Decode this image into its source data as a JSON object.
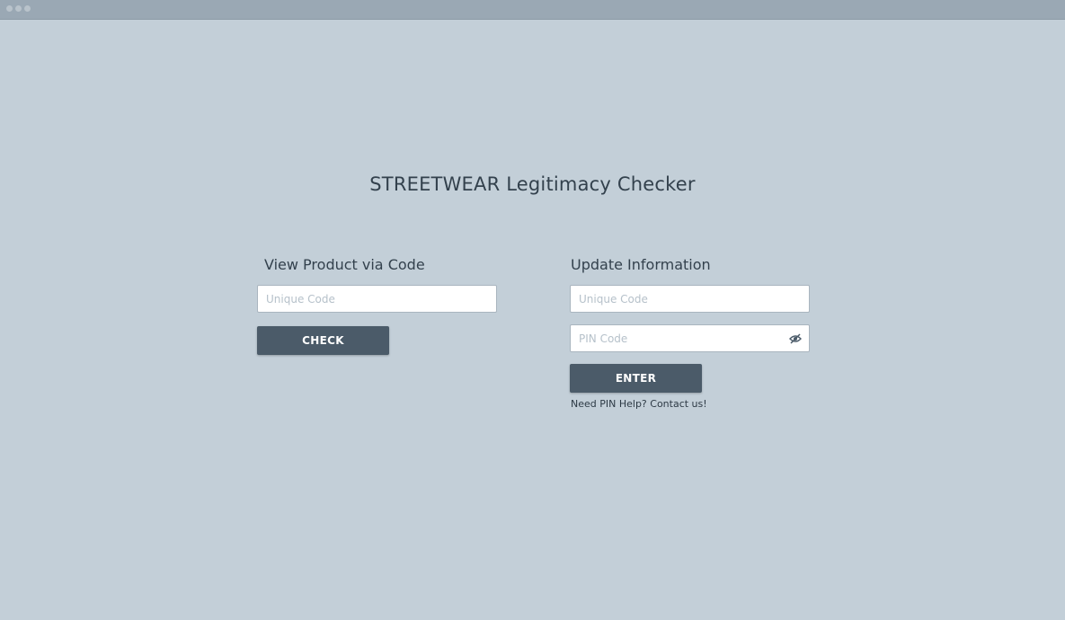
{
  "page": {
    "title": "STREETWEAR Legitimacy Checker"
  },
  "view_section": {
    "heading": "View Product via Code",
    "code_placeholder": "Unique Code",
    "check_label": "CHECK"
  },
  "update_section": {
    "heading": "Update Information",
    "code_placeholder": "Unique Code",
    "pin_placeholder": "PIN Code",
    "enter_label": "ENTER",
    "help_text": "Need PIN Help? Contact us!"
  },
  "colors": {
    "background": "#c3cfd8",
    "button": "#4b5b69",
    "text": "#33414d"
  }
}
